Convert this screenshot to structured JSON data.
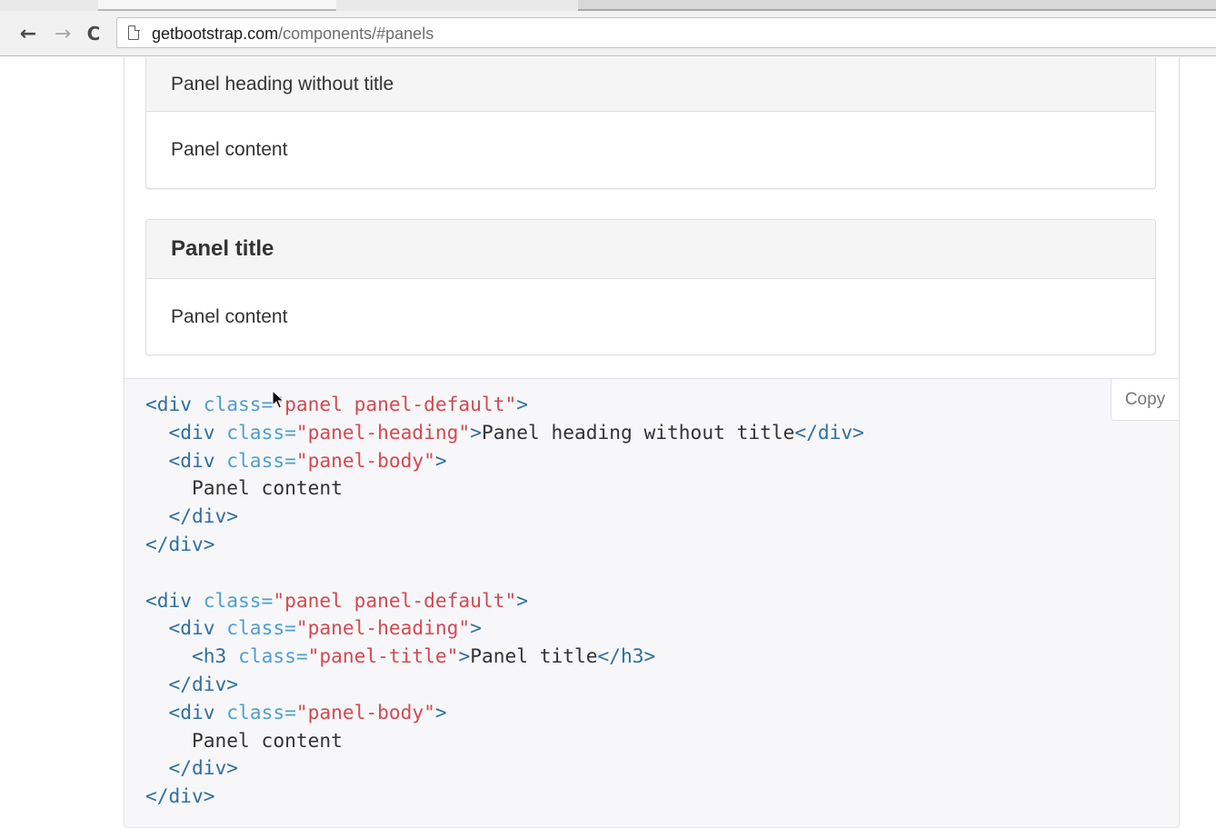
{
  "browser": {
    "nav": {
      "back_label": "←",
      "forward_label": "→",
      "reload_label": "C"
    },
    "url_host": "getbootstrap.com",
    "url_path": "/components/#panels"
  },
  "examples": {
    "panel1": {
      "heading": "Panel heading without title",
      "body": "Panel content"
    },
    "panel2": {
      "title": "Panel title",
      "body": "Panel content"
    }
  },
  "snippet": {
    "copy_label": "Copy",
    "lines": [
      [
        {
          "c": "tg",
          "t": "<div "
        },
        {
          "c": "at",
          "t": "class="
        },
        {
          "c": "st",
          "t": "\"panel panel-default\""
        },
        {
          "c": "tg",
          "t": ">"
        }
      ],
      [
        {
          "c": "tx",
          "t": "  "
        },
        {
          "c": "tg",
          "t": "<div "
        },
        {
          "c": "at",
          "t": "class="
        },
        {
          "c": "st",
          "t": "\"panel-heading\""
        },
        {
          "c": "tg",
          "t": ">"
        },
        {
          "c": "tx",
          "t": "Panel heading without title"
        },
        {
          "c": "tg",
          "t": "</div>"
        }
      ],
      [
        {
          "c": "tx",
          "t": "  "
        },
        {
          "c": "tg",
          "t": "<div "
        },
        {
          "c": "at",
          "t": "class="
        },
        {
          "c": "st",
          "t": "\"panel-body\""
        },
        {
          "c": "tg",
          "t": ">"
        }
      ],
      [
        {
          "c": "tx",
          "t": "    Panel content"
        }
      ],
      [
        {
          "c": "tx",
          "t": "  "
        },
        {
          "c": "tg",
          "t": "</div>"
        }
      ],
      [
        {
          "c": "tg",
          "t": "</div>"
        }
      ],
      [
        {
          "c": "tx",
          "t": ""
        }
      ],
      [
        {
          "c": "tg",
          "t": "<div "
        },
        {
          "c": "at",
          "t": "class="
        },
        {
          "c": "st",
          "t": "\"panel panel-default\""
        },
        {
          "c": "tg",
          "t": ">"
        }
      ],
      [
        {
          "c": "tx",
          "t": "  "
        },
        {
          "c": "tg",
          "t": "<div "
        },
        {
          "c": "at",
          "t": "class="
        },
        {
          "c": "st",
          "t": "\"panel-heading\""
        },
        {
          "c": "tg",
          "t": ">"
        }
      ],
      [
        {
          "c": "tx",
          "t": "    "
        },
        {
          "c": "tg",
          "t": "<h3 "
        },
        {
          "c": "at",
          "t": "class="
        },
        {
          "c": "st",
          "t": "\"panel-title\""
        },
        {
          "c": "tg",
          "t": ">"
        },
        {
          "c": "tx",
          "t": "Panel title"
        },
        {
          "c": "tg",
          "t": "</h3>"
        }
      ],
      [
        {
          "c": "tx",
          "t": "  "
        },
        {
          "c": "tg",
          "t": "</div>"
        }
      ],
      [
        {
          "c": "tx",
          "t": "  "
        },
        {
          "c": "tg",
          "t": "<div "
        },
        {
          "c": "at",
          "t": "class="
        },
        {
          "c": "st",
          "t": "\"panel-body\""
        },
        {
          "c": "tg",
          "t": ">"
        }
      ],
      [
        {
          "c": "tx",
          "t": "    Panel content"
        }
      ],
      [
        {
          "c": "tx",
          "t": "  "
        },
        {
          "c": "tg",
          "t": "</div>"
        }
      ],
      [
        {
          "c": "tg",
          "t": "</div>"
        }
      ]
    ]
  },
  "colors": {
    "tag": "#2f6f9f",
    "attribute": "#4f9fcf",
    "string": "#d44950",
    "text": "#333333",
    "panel_heading_bg": "#f5f5f5",
    "code_bg": "#f7f7f9"
  },
  "icons": {
    "back": "arrow-left-icon",
    "forward": "arrow-right-icon",
    "reload": "reload-icon",
    "page": "page-icon",
    "cursor": "mouse-cursor-icon"
  }
}
